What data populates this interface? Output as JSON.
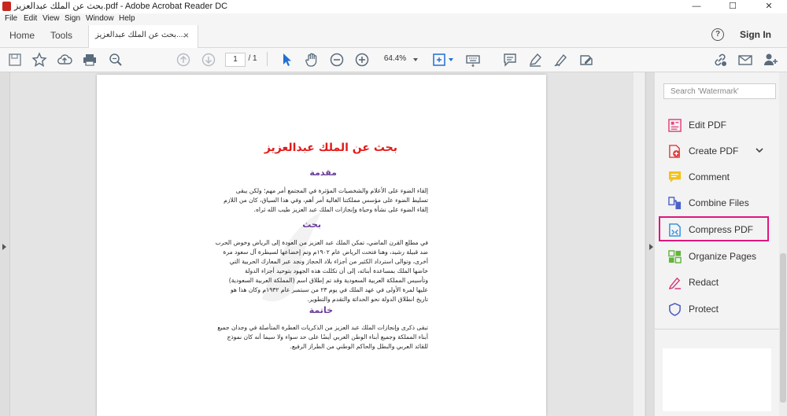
{
  "window": {
    "title": "بحث عن الملك عبدالعزيز.pdf - Adobe Acrobat Reader DC",
    "minimize": "—",
    "maximize": "☐",
    "close": "✕"
  },
  "menu": [
    "File",
    "Edit",
    "View",
    "Sign",
    "Window",
    "Help"
  ],
  "tabs": {
    "home": "Home",
    "tools": "Tools",
    "document": "بحث عن الملك عبدالعزيز....",
    "close": "×"
  },
  "header": {
    "help": "?",
    "sign_in": "Sign In"
  },
  "toolbar": {
    "page_current": "1",
    "page_total": "/ 1",
    "zoom": "64.4%"
  },
  "document": {
    "title": "بحث عن الملك عبدالعزيز",
    "sections": [
      {
        "heading": "مقدمة",
        "lines": [
          "إلقاء الضوء على الأعلام والشخصيات المؤثرة في المجتمع أمر مهم؛ ولكن يبقى",
          "تسليط الضوء على مؤسس مملكتنا الغالية أمر أهم، وفي هذا السياق، كان من اللازم",
          "إلقاء الضوء على نشأة وحياة وإنجازات الملك عبد العزيز طيب الله ثراه."
        ]
      },
      {
        "heading": "بحث",
        "lines": [
          "في مطلع القرن الماضي، تمكن الملك عبد العزيز من العودة إلى الرياض وخوض الحرب",
          "ضد قبيلة رشيد، وهنا فتحت الرياض عام ١٩٠٢م وتم إخضاعها لسيطرة آل سعود مرة",
          "أخرى، وتوالى استرداد الكثير من أجزاء بلاد الحجاز ونجد عبر المعارك الحربية التي",
          "خاضها الملك بمساعدة أبنائه، إلى أن تكللت هذه الجهود بتوحيد أجزاء الدولة",
          "وتأسيس المملكة العربية السعودية وقد تم إطلاق اسم (المملكة العربية السعودية)",
          "عليها لمرة الأولى في عهد الملك في يوم ٢٣ من سبتمبر عام ١٩٣٢م وكان هذا هو",
          "تاريخ انطلاق الدولة نحو الحداثة والتقدم والتطوير."
        ]
      },
      {
        "heading": "خاتمة",
        "lines": [
          "تبقى ذكرى وإنجازات الملك عبد العزيز من الذكريات العطرة المتأصلة في وجدان جميع",
          "أبناء المملكة وجميع أبناء الوطن العربي أيضًا على حد سواء ولا سيما أنه كان نموذج",
          "للقائد العربي والبطل والحاكم الوطني من الطراز الرفيع."
        ]
      }
    ]
  },
  "right_panel": {
    "search_placeholder": "Search 'Watermark'",
    "tools": [
      {
        "label": "Edit PDF",
        "icon": "edit-pdf-icon",
        "color": "#e4457e"
      },
      {
        "label": "Create PDF",
        "icon": "create-pdf-icon",
        "color": "#e43a3a"
      },
      {
        "label": "Comment",
        "icon": "comment-icon",
        "color": "#f2c21a"
      },
      {
        "label": "Combine Files",
        "icon": "combine-files-icon",
        "color": "#4a63c9"
      },
      {
        "label": "Compress PDF",
        "icon": "compress-pdf-icon",
        "color": "#2b8ddb"
      },
      {
        "label": "Organize Pages",
        "icon": "organize-pages-icon",
        "color": "#62b43a"
      },
      {
        "label": "Redact",
        "icon": "redact-icon",
        "color": "#d9347a"
      },
      {
        "label": "Protect",
        "icon": "protect-icon",
        "color": "#4b5bc7"
      }
    ]
  },
  "colors": {
    "title_red": "#e21b1b",
    "heading_purple": "#6a3d9a",
    "highlight_pink": "#e0167f",
    "toolbar_icon": "#5a6b7c"
  }
}
